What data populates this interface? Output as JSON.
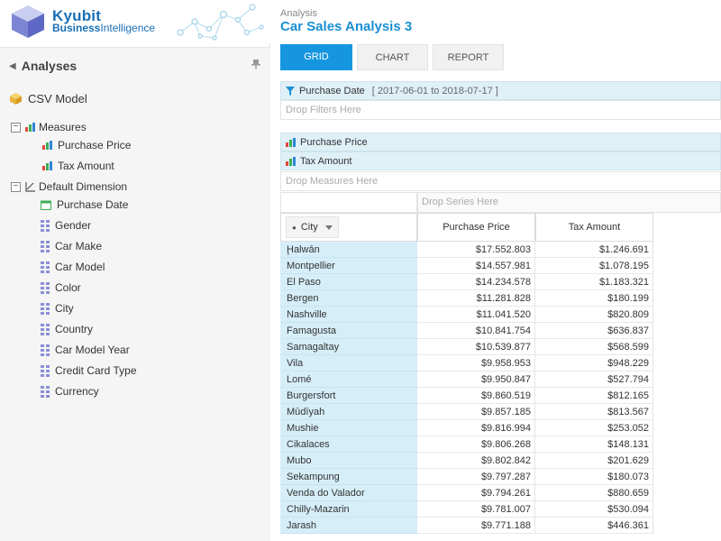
{
  "app": {
    "logo_line1": "Kyubit",
    "logo_line2_a": "Business",
    "logo_line2_b": "Intelligence"
  },
  "panel": {
    "title": "Analyses",
    "model_name": "CSV Model",
    "measures_label": "Measures",
    "measures": [
      "Purchase Price",
      "Tax Amount"
    ],
    "dimension_label": "Default Dimension",
    "date_field": "Purchase Date",
    "attributes": [
      "Gender",
      "Car Make",
      "Car Model",
      "Color",
      "City",
      "Country",
      "Car Model Year",
      "Credit Card Type",
      "Currency"
    ],
    "toggle_symbol": "−"
  },
  "header": {
    "breadcrumb": "Analysis",
    "title": "Car Sales Analysis 3"
  },
  "tabs": {
    "grid": "GRID",
    "chart": "CHART",
    "report": "REPORT"
  },
  "filters": {
    "field": "Purchase Date",
    "range": "[ 2017-06-01 to 2018-07-17 ]",
    "drop_hint": "Drop Filters Here"
  },
  "measures_zone": {
    "items": [
      "Purchase Price",
      "Tax Amount"
    ],
    "drop_hint": "Drop Measures Here"
  },
  "series_zone": {
    "drop_hint": "Drop Series Here"
  },
  "grid": {
    "row_field": "City",
    "columns": [
      "Purchase Price",
      "Tax Amount"
    ],
    "rows": [
      {
        "city": "Ḩalwān",
        "price": "$17.552.803",
        "tax": "$1.246.691"
      },
      {
        "city": "Montpellier",
        "price": "$14.557.981",
        "tax": "$1.078.195"
      },
      {
        "city": "El Paso",
        "price": "$14.234.578",
        "tax": "$1.183.321"
      },
      {
        "city": "Bergen",
        "price": "$11.281.828",
        "tax": "$180.199"
      },
      {
        "city": "Nashville",
        "price": "$11.041.520",
        "tax": "$820.809"
      },
      {
        "city": "Famagusta",
        "price": "$10.841.754",
        "tax": "$636.837"
      },
      {
        "city": "Samagaltay",
        "price": "$10.539.877",
        "tax": "$568.599"
      },
      {
        "city": "Vila",
        "price": "$9.958.953",
        "tax": "$948.229"
      },
      {
        "city": "Lomé",
        "price": "$9.950.847",
        "tax": "$527.794"
      },
      {
        "city": "Burgersfort",
        "price": "$9.860.519",
        "tax": "$812.165"
      },
      {
        "city": "Mūdīyah",
        "price": "$9.857.185",
        "tax": "$813.567"
      },
      {
        "city": "Mushie",
        "price": "$9.816.994",
        "tax": "$253.052"
      },
      {
        "city": "Cikalaces",
        "price": "$9.806.268",
        "tax": "$148.131"
      },
      {
        "city": "Mubo",
        "price": "$9.802.842",
        "tax": "$201.629"
      },
      {
        "city": "Sekampung",
        "price": "$9.797.287",
        "tax": "$180.073"
      },
      {
        "city": "Venda do Valador",
        "price": "$9.794.261",
        "tax": "$880.659"
      },
      {
        "city": "Chilly-Mazarin",
        "price": "$9.781.007",
        "tax": "$530.094"
      },
      {
        "city": "Jarash",
        "price": "$9.771.188",
        "tax": "$446.361"
      }
    ]
  },
  "colors": {
    "accent": "#1696df",
    "title_blue": "#1a8fd4",
    "zone_bg": "#dff0f7",
    "row_header_bg": "#d6eef8"
  },
  "icons": {
    "back": "caret-left-icon",
    "pin": "pin-icon",
    "model": "cube-icon",
    "measure": "bar-chart-icon",
    "dimension": "axis-icon",
    "date": "calendar-icon",
    "attribute": "grid-icon",
    "filter": "funnel-icon"
  }
}
